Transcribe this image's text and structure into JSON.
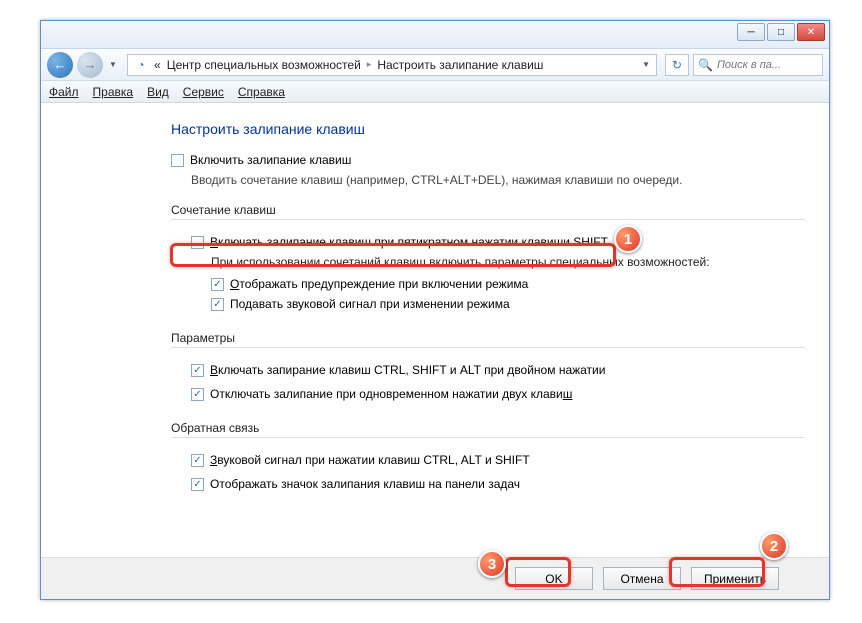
{
  "titlebar": {
    "minimize": "─",
    "maximize": "□",
    "close": "✕"
  },
  "nav": {
    "back": "←",
    "forward": "→",
    "dropdown": "▼",
    "prefix": "«",
    "crumb1": "Центр специальных возможностей",
    "sep": "▸",
    "crumb2": "Настроить залипание клавиш",
    "addrdd": "▼",
    "refresh": "↻",
    "search_placeholder": "Поиск в па..."
  },
  "menu": {
    "file": "Файл",
    "edit": "Правка",
    "view": "Вид",
    "tools": "Сервис",
    "help": "Справка"
  },
  "page": {
    "heading": "Настроить залипание клавиш",
    "enable_label": "Включить залипание клавиш",
    "enable_desc": "Вводить сочетание клавиш (например, CTRL+ALT+DEL), нажимая клавиши по очереди.",
    "group1": "Сочетание клавиш",
    "shift5_label": "Включать залипание клавиш при пятикратном нажатии клавиши SHIFT",
    "subtext": "При использовании сочетаний клавиш включить параметры специальных возможностей:",
    "warn_label": "Отображать предупреждение при включении режима",
    "sound_label": "Подавать звуковой сигнал при изменении режима",
    "group2": "Параметры",
    "lock_label": "Включать запирание клавиш CTRL, SHIFT и ALT при двойном нажатии",
    "off_label": "Отключать залипание при одновременном нажатии двух клавиш",
    "group3": "Обратная связь",
    "beep_label": "Звуковой сигнал при нажатии клавиш CTRL, ALT и SHIFT",
    "tray_label": "Отображать значок залипания клавиш на панели задач"
  },
  "buttons": {
    "ok": "OK",
    "cancel": "Отмена",
    "apply": "Применить"
  },
  "badges": {
    "b1": "1",
    "b2": "2",
    "b3": "3"
  }
}
